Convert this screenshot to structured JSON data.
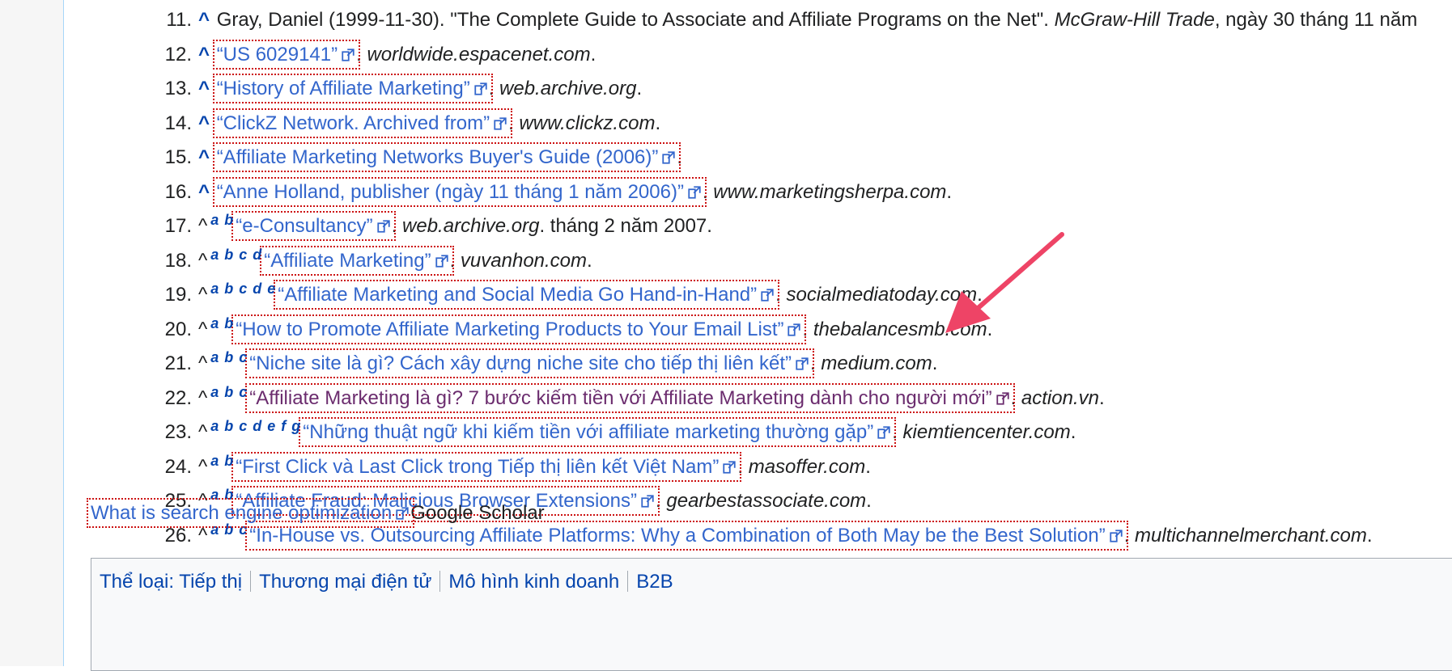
{
  "references": [
    {
      "num": "11.",
      "caret": "^",
      "letters": "",
      "pre": "Gray, Daniel (1999-11-30). \"The Complete Guide to Associate and Affiliate Programs on the Net\". ",
      "journal": "McGraw-Hill Trade",
      "post": ", ngày 30 tháng 11 năm"
    },
    {
      "num": "12.",
      "caret": "^",
      "letters": "",
      "title": "“US 6029141”",
      "site": "worldwide.espacenet.com"
    },
    {
      "num": "13.",
      "caret": "^",
      "letters": "",
      "title": "“History of Affiliate Marketing”",
      "site": "web.archive.org"
    },
    {
      "num": "14.",
      "caret": "^",
      "letters": "",
      "title": "“ClickZ Network. Archived from”",
      "site": "www.clickz.com"
    },
    {
      "num": "15.",
      "caret": "^",
      "letters": "",
      "title": "“Affiliate Marketing Networks Buyer's Guide (2006)”",
      "site": ""
    },
    {
      "num": "16.",
      "caret": "^",
      "letters": "",
      "title": "“Anne Holland, publisher (ngày 11 tháng 1 năm 2006)”",
      "site": "www.marketingsherpa.com"
    },
    {
      "num": "17.",
      "caret": "^",
      "letters": "a b",
      "title": "“e-Consultancy”",
      "site": "web.archive.org",
      "after": " tháng 2 năm 2007."
    },
    {
      "num": "18.",
      "caret": "^",
      "letters": "a b c d",
      "title": "“Affiliate Marketing”",
      "site": "vuvanhon.com"
    },
    {
      "num": "19.",
      "caret": "^",
      "letters": "a b c d e",
      "title": "“Affiliate Marketing and Social Media Go Hand-in-Hand”",
      "site": "socialmediatoday.com"
    },
    {
      "num": "20.",
      "caret": "^",
      "letters": "a b",
      "title": "“How to Promote Affiliate Marketing Products to Your Email List”",
      "site": "thebalancesmb.com"
    },
    {
      "num": "21.",
      "caret": "^",
      "letters": "a b c",
      "title": "“Niche site là gì? Cách xây dựng niche site cho tiếp thị liên kết”",
      "site": "medium.com"
    },
    {
      "num": "22.",
      "caret": "^",
      "letters": "a b c",
      "title": "“Affiliate Marketing là gì? 7 bước kiếm tiền với Affiliate Marketing dành cho người mới”",
      "site": "action.vn",
      "visited": true
    },
    {
      "num": "23.",
      "caret": "^",
      "letters": "a b c d e f g",
      "title": "“Những thuật ngữ khi kiếm tiền với affiliate marketing thường gặp”",
      "site": "kiemtiencenter.com"
    },
    {
      "num": "24.",
      "caret": "^",
      "letters": "a b",
      "title": "“First Click và Last Click trong Tiếp thị liên kết Việt Nam”",
      "site": "masoffer.com"
    },
    {
      "num": "25.",
      "caret": "^",
      "letters": "a b",
      "title": "“Affiliate Fraud: Malicious Browser Extensions”",
      "site": "gearbestassociate.com"
    },
    {
      "num": "26.",
      "caret": "^",
      "letters": "a b c",
      "title": "“In-House vs. Outsourcing Affiliate Platforms: Why a Combination of Both May be the Best Solution”",
      "site": "multichannelmerchant.com"
    }
  ],
  "seo": {
    "link": "What is search engine optimization",
    "text": "Google Scholar"
  },
  "categories": {
    "label": "Thể loại:",
    "items": [
      "Tiếp thị",
      "Thương mại điện tử",
      "Mô hình kinh doanh",
      "B2B"
    ]
  },
  "colors": {
    "link": "#3366cc",
    "visited": "#6b2c6e",
    "annotation": "#cc1111",
    "arrow": "#ee4466"
  }
}
